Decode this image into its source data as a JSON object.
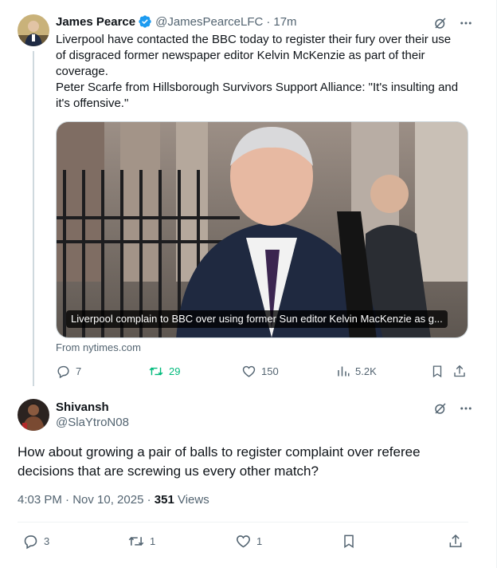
{
  "tweet": {
    "author_name": "James Pearce",
    "handle": "@JamesPearceLFC",
    "separator": "·",
    "time": "17m",
    "lines": [
      "Liverpool have contacted the BBC today to register their fury over their use of disgraced former newspaper editor Kelvin McKenzie as part of their coverage.",
      "Peter Scarfe from Hillsborough Survivors Support Alliance: \"It's insulting and it's offensive.\""
    ],
    "card": {
      "caption": "Liverpool complain to BBC over using former Sun editor Kelvin MacKenzie as g...",
      "source": "From nytimes.com"
    },
    "stats": {
      "replies": "7",
      "retweets": "29",
      "likes": "150",
      "views": "5.2K"
    },
    "colors": {
      "verified": "#1d9bf0",
      "retweet_active": "#00ba7c"
    }
  },
  "reply": {
    "author_name": "Shivansh",
    "handle": "@SlaYtroN08",
    "text": "How about growing a pair of balls to register complaint over referee decisions that are screwing us every other match?",
    "timestamp": "4:03 PM · Nov 10, 2025 · ",
    "views_count": "351",
    "views_label": " Views",
    "stats": {
      "replies": "3",
      "retweets": "1",
      "likes": "1"
    }
  },
  "icons": [
    "grok-icon",
    "more-icon",
    "reply-icon",
    "retweet-icon",
    "like-icon",
    "views-icon",
    "bookmark-icon",
    "share-icon",
    "verified-badge-icon"
  ]
}
